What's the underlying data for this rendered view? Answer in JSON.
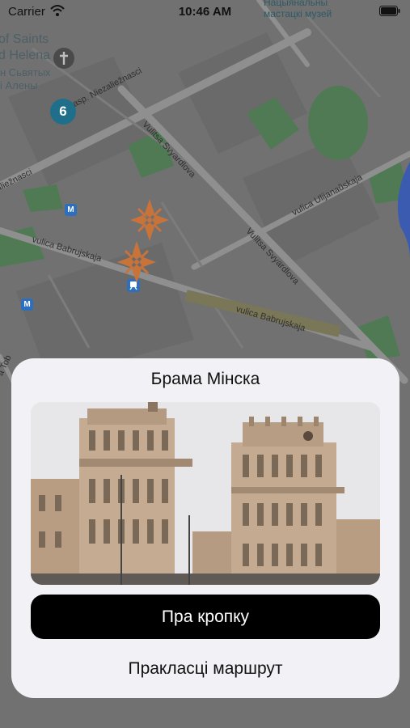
{
  "status_bar": {
    "carrier": "Carrier",
    "time": "10:46 AM"
  },
  "map": {
    "pois": {
      "church_line1": "of Saints",
      "church_line2": "d Helena",
      "church_local1": "н Сьвятых",
      "church_local2": "і Алены",
      "museum_line1": "Нацыянальны",
      "museum_line2": "мастацкі музей",
      "cluster_count": "6",
      "metro_label": "M"
    },
    "streets": {
      "niezaleznasci_1": "prasp. Niezaliežnasci",
      "niezaleznasci_2": "aliežnasci",
      "svyardlova_1": "Vulitsa Svyardlova",
      "svyardlova_2": "Vulitsa Svyardlova",
      "ulijanauskaja": "vulica Ulijanaŭskaja",
      "babrujskaja_1": "vulica Babrujskaja",
      "babrujskaja_2": "vulica Babrujskaja",
      "tobolsk": "a Tob"
    },
    "colors": {
      "marker": "#c8733a",
      "cluster": "#1f6f8b",
      "metro": "#2d6fbf",
      "park": "#5f8a5c",
      "water": "#3a5bb0"
    }
  },
  "card": {
    "title": "Брама Мінска",
    "primary_button": "Пра кропку",
    "secondary_button": "Праклaсці маршрут"
  }
}
